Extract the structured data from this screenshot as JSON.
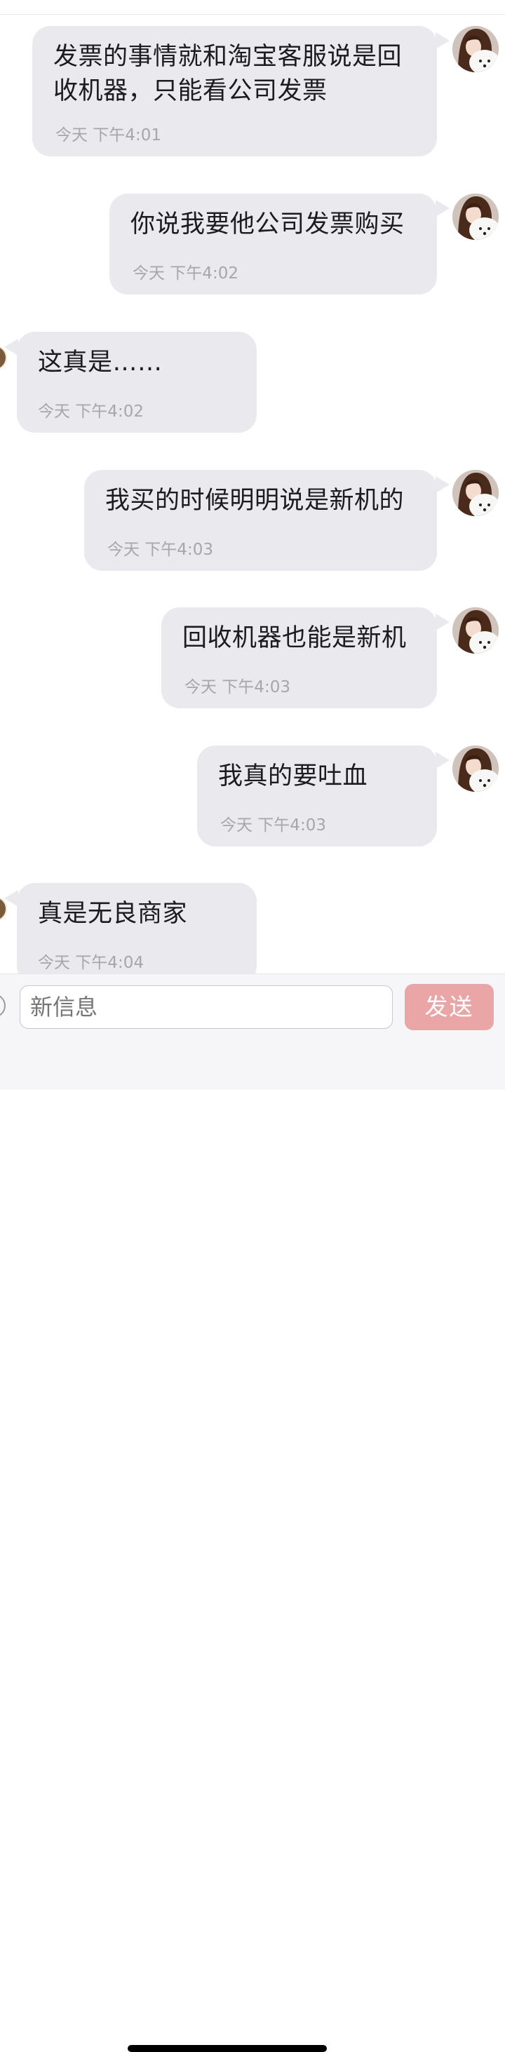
{
  "messages": [
    {
      "side": "outgoing",
      "text": "发票的事情就和淘宝客服说是回收机器，只能看公司发票",
      "time": "今天 下午4:01"
    },
    {
      "side": "outgoing",
      "text": "你说我要他公司发票购买",
      "time": "今天 下午4:02"
    },
    {
      "side": "incoming",
      "text": "这真是……",
      "time": "今天 下午4:02"
    },
    {
      "side": "outgoing",
      "text": "我买的时候明明说是新机的",
      "time": "今天 下午4:03"
    },
    {
      "side": "outgoing",
      "text": "回收机器也能是新机",
      "time": "今天 下午4:03"
    },
    {
      "side": "outgoing",
      "text": "我真的要吐血",
      "time": "今天 下午4:03"
    },
    {
      "side": "incoming",
      "text": "真是无良商家",
      "time": "今天 下午4:04"
    }
  ],
  "composer": {
    "placeholder": "新信息",
    "send_label": "发送"
  },
  "colors": {
    "bubble": "#e9e9ee",
    "send_button": "#eaa6a6",
    "timestamp": "#a6a6ab"
  },
  "icons": {
    "user_avatar": "avatar-girl-with-white-dog"
  }
}
